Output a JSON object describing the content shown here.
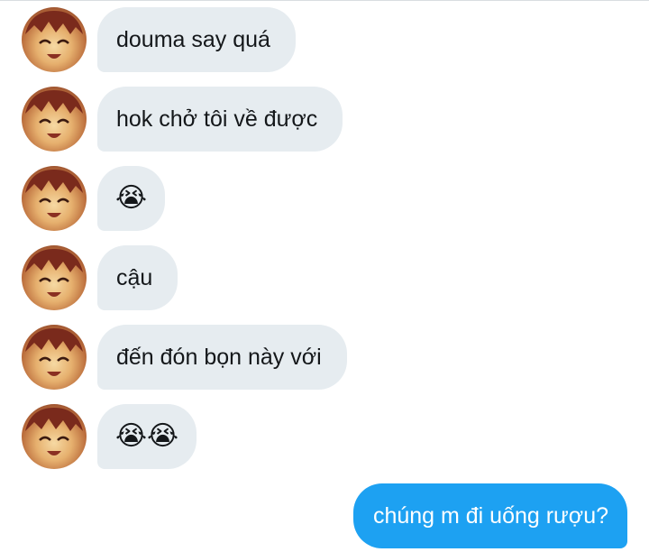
{
  "colors": {
    "incoming_bubble": "#e6ecf0",
    "outgoing_bubble": "#1da1f2",
    "incoming_text": "#14171a",
    "outgoing_text": "#ffffff"
  },
  "messages": [
    {
      "direction": "incoming",
      "avatar": "anime-character-avatar",
      "text": "douma say quá"
    },
    {
      "direction": "incoming",
      "avatar": "anime-character-avatar",
      "text": "hok chở tôi về được"
    },
    {
      "direction": "incoming",
      "avatar": "anime-character-avatar",
      "text": "😭"
    },
    {
      "direction": "incoming",
      "avatar": "anime-character-avatar",
      "text": "cậu"
    },
    {
      "direction": "incoming",
      "avatar": "anime-character-avatar",
      "text": "đến đón bọn này với"
    },
    {
      "direction": "incoming",
      "avatar": "anime-character-avatar",
      "text": "😭😭"
    },
    {
      "direction": "outgoing",
      "text": "chúng m đi uống rượu?"
    }
  ]
}
